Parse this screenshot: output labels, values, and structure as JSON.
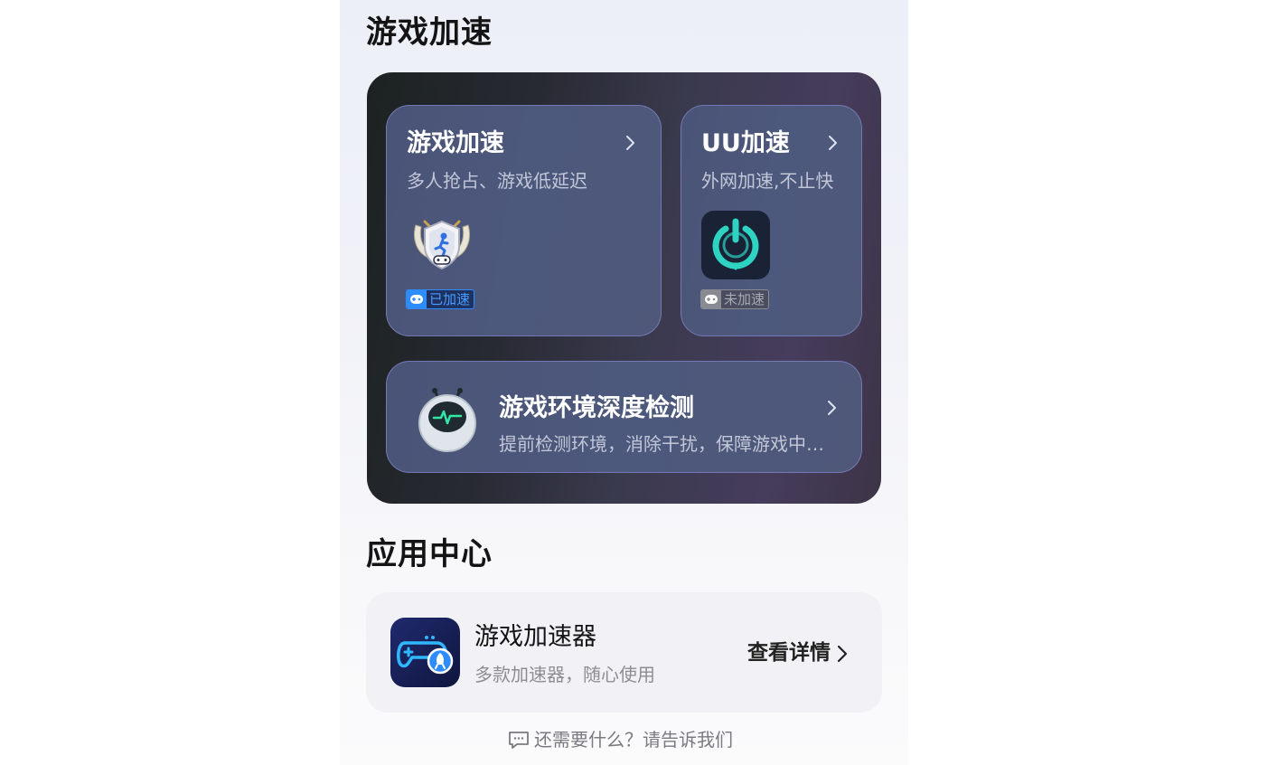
{
  "sections": {
    "game_accel_title": "游戏加速",
    "app_center_title": "应用中心"
  },
  "cards": {
    "game_accel": {
      "title": "游戏加速",
      "subtitle": "多人抢占、游戏低延迟",
      "status": "已加速",
      "icon": "winged-shield-gamer-icon"
    },
    "uu_accel": {
      "title": "UU加速",
      "subtitle": "外网加速,不止快",
      "status": "未加速",
      "icon": "uu-power-icon"
    },
    "env_check": {
      "title": "游戏环境深度检测",
      "subtitle": "提前检测环境，消除干扰，保障游戏中…",
      "icon": "robot-heartbeat-icon"
    }
  },
  "app_center": {
    "app_name": "游戏加速器",
    "app_desc": "多款加速器，随心使用",
    "details_label": "查看详情",
    "icon": "gamepad-rocket-icon"
  },
  "feedback": {
    "text": "还需要什么？请告诉我们",
    "icon": "message-icon"
  },
  "colors": {
    "accent_blue": "#2f8cff",
    "uu_teal": "#2fd3c2",
    "badge_inactive": "#9a9aa2"
  }
}
